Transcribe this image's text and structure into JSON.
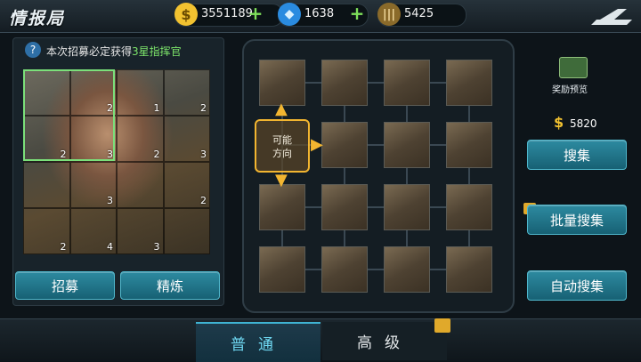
{
  "header": {
    "title": "情报局"
  },
  "resources": [
    {
      "icon": "dollar-icon",
      "value": "3551189"
    },
    {
      "icon": "diamond-icon",
      "value": "1638"
    },
    {
      "icon": "ammo-icon",
      "value": "5425"
    }
  ],
  "left": {
    "tip_prefix": "本次招募必定获得",
    "tip_highlight": "3星指挥官",
    "grid_numbers": [
      "",
      "3",
      "2",
      "",
      "",
      "2",
      "3",
      "2",
      "",
      "",
      "2",
      "3",
      "",
      "1",
      "",
      "",
      "2",
      "",
      "",
      "",
      "",
      "2",
      "4",
      "3"
    ],
    "recruit_label": "招募",
    "refine_label": "精炼"
  },
  "board": {
    "direction_label_1": "可能",
    "direction_label_2": "方向"
  },
  "right": {
    "reward_label": "奖励预览",
    "cost": "5820",
    "collect_label": "搜集",
    "batch_collect_label": "批量搜集",
    "auto_collect_label": "自动搜集"
  },
  "tabs": {
    "normal": "普通",
    "advanced": "高级"
  }
}
